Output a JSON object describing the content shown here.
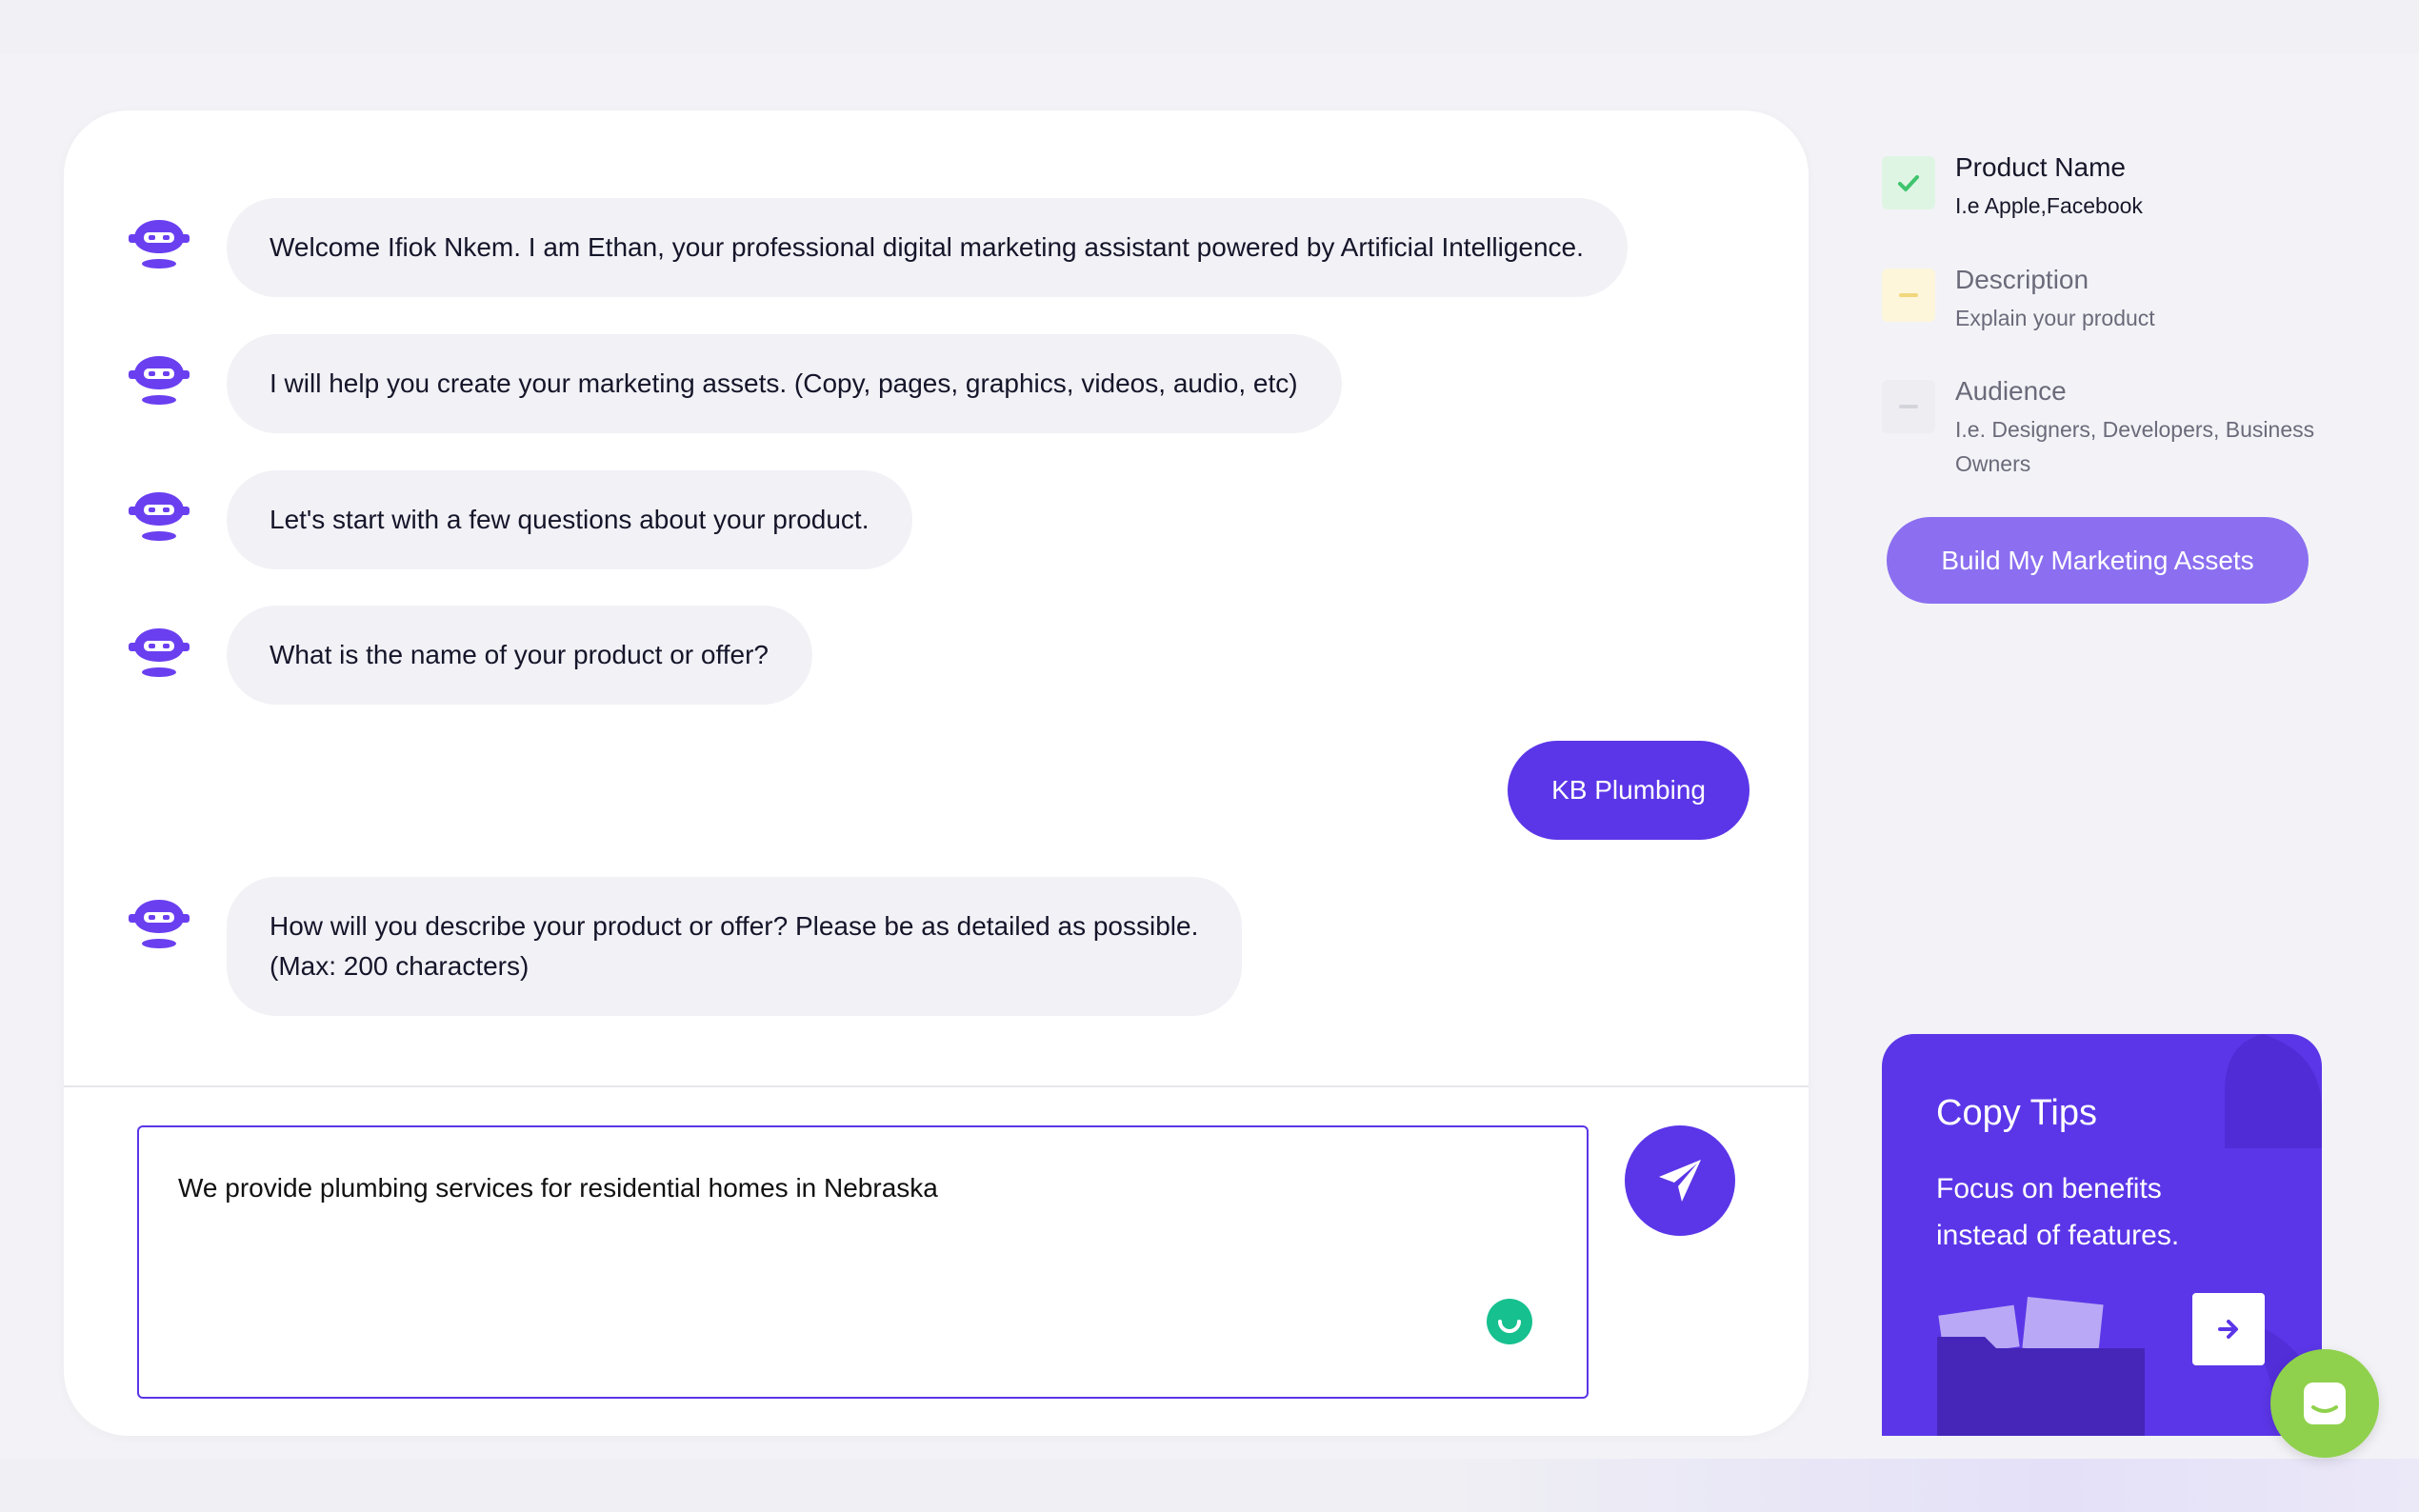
{
  "chat": {
    "messages": [
      {
        "from": "bot",
        "text": "Welcome Ifiok Nkem. I am Ethan, your professional digital marketing assistant powered by Artificial Intelligence."
      },
      {
        "from": "bot",
        "text": "I will help you create your marketing assets. (Copy, pages, graphics, videos, audio, etc)"
      },
      {
        "from": "bot",
        "text": "Let's start with a few questions about your product."
      },
      {
        "from": "bot",
        "text": "What is the name of your product or offer?"
      },
      {
        "from": "user",
        "text": "KB Plumbing"
      },
      {
        "from": "bot",
        "line1": "How will you describe your product or offer? Please be as detailed as possible.",
        "line2": "(Max: 200 characters)"
      }
    ],
    "input": {
      "value": "We provide plumbing services for residential homes in Nebraska"
    }
  },
  "steps": [
    {
      "title": "Product Name",
      "subtitle": "I.e Apple,Facebook",
      "status": "complete"
    },
    {
      "title": "Description",
      "subtitle": "Explain your product",
      "status": "in-progress"
    },
    {
      "title": "Audience",
      "subtitle": "I.e. Designers, Developers, Business Owners",
      "status": "pending"
    }
  ],
  "build_button": {
    "label": "Build My Marketing Assets"
  },
  "tips": {
    "title": "Copy Tips",
    "text": "Focus on benefits instead of features."
  },
  "colors": {
    "accent": "#5b36e8",
    "accent_light": "#8b6ff0",
    "success": "#3ec46d",
    "warning_bg": "#fdf6da",
    "launcher": "#8fd14c"
  }
}
